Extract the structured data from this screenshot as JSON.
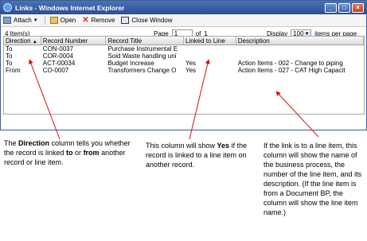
{
  "window": {
    "title": "Links - Windows Internet Explorer"
  },
  "toolbar": {
    "attach": "Attach",
    "open": "Open",
    "remove": "Remove",
    "close_window": "Close Window"
  },
  "info": {
    "count": "4 Item(s)",
    "page_label": "Page",
    "page_value": "1",
    "of_label": "of",
    "total_pages": "1",
    "display_label": "Display",
    "display_value": "100",
    "per_page_label": "items per page"
  },
  "grid": {
    "columns": [
      "Direction",
      "Record Number",
      "Record Title",
      "Linked to Line",
      "Description"
    ],
    "rows": [
      [
        "To",
        "CON-0037",
        "Purchase Instrumental E",
        "",
        ""
      ],
      [
        "To",
        "COR-0004",
        "Soid Waste handling uni",
        "",
        ""
      ],
      [
        "To",
        "ACT-00034",
        "Budget Increase",
        "Yes",
        "Action Items - 002 - Change to piping"
      ],
      [
        "From",
        "CO-0007",
        "Transformers Change O",
        "Yes",
        "Action Items - 027 - CAT High Capacit"
      ]
    ]
  },
  "captions": {
    "left_1": "The ",
    "left_bold1": "Direction",
    "left_2": " column tells you whether the record is linked ",
    "left_bold2": "to",
    "left_3": " or ",
    "left_bold3": "from",
    "left_4": " another record or line item.",
    "mid_1": "This column will show ",
    "mid_bold": "Yes",
    "mid_2": " if the record is linked to a line item on another record.",
    "right": "If the link is to a line item, this column will show the name of the business process, the number of the line item, and its description. (If the line item is from a Document BP, the column will show the line item name.)"
  },
  "colors": {
    "titlebar": "#2a4f93",
    "arrow": "#d01010"
  }
}
